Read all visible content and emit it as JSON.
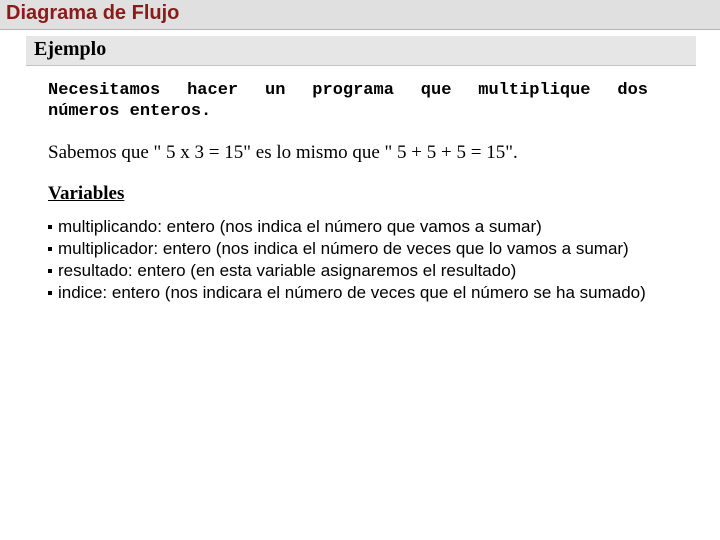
{
  "title": "Diagrama de Flujo",
  "subtitle": "Ejemplo",
  "intro_line1": "Necesitamos hacer un programa que multiplique dos",
  "intro_line2": "números enteros.",
  "sabemos": "Sabemos que \" 5 x 3 = 15\" es lo mismo que \" 5 + 5 + 5 = 15\".",
  "variables_heading": "Variables",
  "variables": {
    "v1": "multiplicando: entero (nos indica el número que vamos a sumar)",
    "v2": "multiplicador: entero (nos indica el número de veces que lo vamos a sumar)",
    "v3": "resultado: entero (en esta variable asignaremos el resultado)",
    "v4": "indice: entero (nos indicara el número de veces que el número se ha sumado)"
  }
}
